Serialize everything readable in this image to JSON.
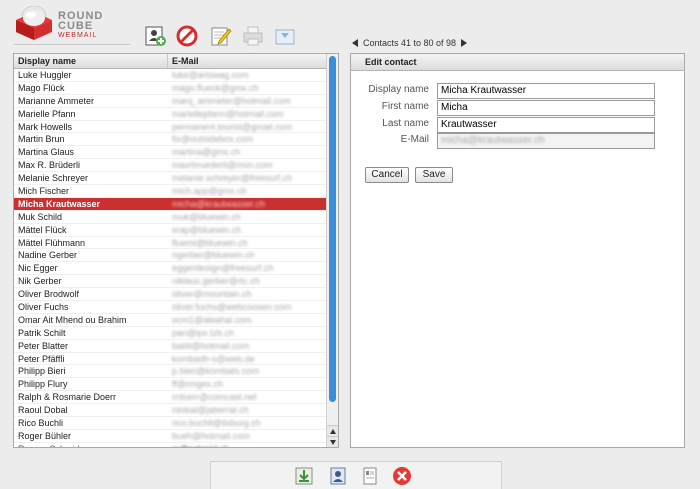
{
  "app": {
    "logo": {
      "line1": "ROUND",
      "line2": "CUBE",
      "line3": "WEBMAIL"
    },
    "brand_color": "#c9302f"
  },
  "toolbar": {
    "icons": [
      "add-contact-icon",
      "delete-icon",
      "edit-icon",
      "print-icon",
      "export-icon"
    ]
  },
  "pager": {
    "text": "Contacts 41 to 80 of 98"
  },
  "list": {
    "headers": {
      "name": "Display name",
      "email": "E-Mail"
    },
    "rows": [
      {
        "name": "Luke Huggler",
        "email": "luke@artswag.com"
      },
      {
        "name": "Mago Flück",
        "email": "mago.flueck@gmx.ch"
      },
      {
        "name": "Marianne Ammeter",
        "email": "marq_ammeter@hotmail.com"
      },
      {
        "name": "Marielle Pfann",
        "email": "mariellepfann@hotmail.com"
      },
      {
        "name": "Mark Howells",
        "email": "permanent.tourist@gmail.com"
      },
      {
        "name": "Martin Brun",
        "email": "fix@outsidebox.com"
      },
      {
        "name": "Martina Glaus",
        "email": "martina@gmx.ch"
      },
      {
        "name": "Max R. Brüderli",
        "email": "maxrbruederli@msn.com"
      },
      {
        "name": "Melanie Schreyer",
        "email": "melanie.schreyer@freesurf.ch"
      },
      {
        "name": "Mich Fischer",
        "email": "mich.app@gmx.ch"
      },
      {
        "name": "Micha Krautwasser",
        "email": "micha@krautwasser.ch",
        "selected": true
      },
      {
        "name": "Muk Schild",
        "email": "muk@bluewin.ch"
      },
      {
        "name": "Mättel Flück",
        "email": "srap@bluewin.ch"
      },
      {
        "name": "Mättel Flühmann",
        "email": "fluemi@bluewin.ch"
      },
      {
        "name": "Nadine Gerber",
        "email": "ngerber@bluewin.ch"
      },
      {
        "name": "Nic Egger",
        "email": "eggerdesign@freesurf.ch"
      },
      {
        "name": "Nik Gerber",
        "email": "niklaus.gerber@rtc.ch"
      },
      {
        "name": "Oliver Brodwolf",
        "email": "oliver@mountain.ch"
      },
      {
        "name": "Oliver Fuchs",
        "email": "oliver.fuchs@webcoosen.com"
      },
      {
        "name": "Omar Ait Mhend ou Brahim",
        "email": "ocm1@aleahal.com"
      },
      {
        "name": "Patrik Schilt",
        "email": "pan@ipx.tzb.ch"
      },
      {
        "name": "Peter Blatter",
        "email": "bablt@hotmail.com"
      },
      {
        "name": "Peter Pfäffli",
        "email": "kombadh-s@web.de"
      },
      {
        "name": "Philipp Bieri",
        "email": "p.bieri@kombats.com"
      },
      {
        "name": "Philipp Flury",
        "email": "ff@rmgex.ch"
      },
      {
        "name": "Ralph & Rosmarie Doerr",
        "email": "rrdoerr@comcast.net"
      },
      {
        "name": "Raoul Dobal",
        "email": "rdobal@jaberrat.ch"
      },
      {
        "name": "Rico Buchli",
        "email": "rico.buchli@tlsburg.ch"
      },
      {
        "name": "Roger Bühler",
        "email": "bueh@hotmail.com"
      },
      {
        "name": "Roman Schmid",
        "email": "rs@schmid.ch",
        "partial": true
      }
    ]
  },
  "edit": {
    "title": "Edit contact",
    "fields": [
      {
        "label": "Display name",
        "value": "Micha Krautwasser"
      },
      {
        "label": "First name",
        "value": "Micha"
      },
      {
        "label": "Last name",
        "value": "Krautwasser"
      },
      {
        "label": "E-Mail",
        "value": "micha@krautwasser.ch",
        "disabled": true
      }
    ],
    "cancel": "Cancel",
    "save": "Save"
  },
  "bottom_toolbar": {
    "icons": [
      "import-icon",
      "address-card-icon",
      "vcard-icon",
      "close-icon"
    ]
  }
}
